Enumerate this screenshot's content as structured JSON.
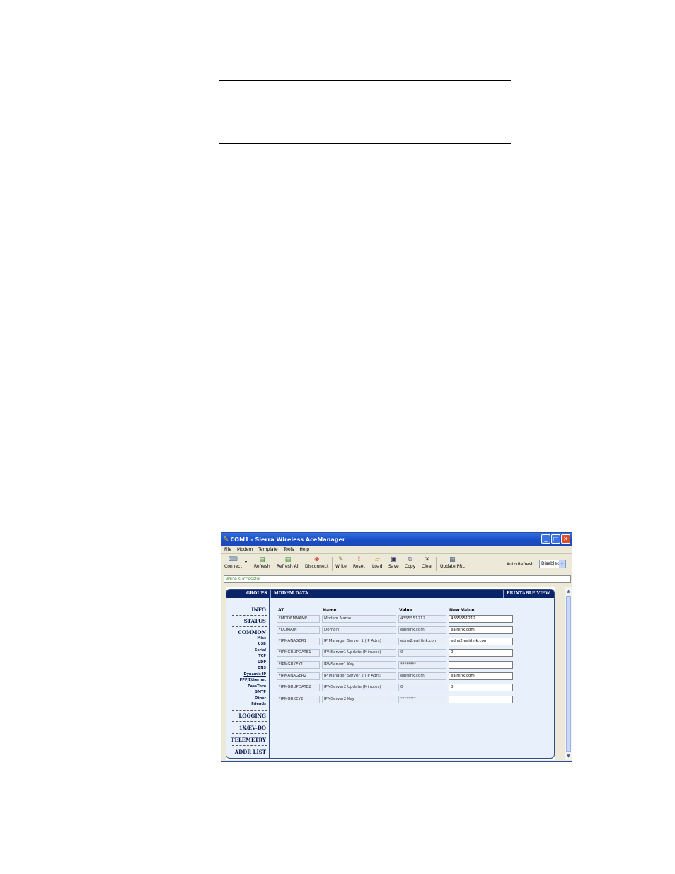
{
  "window": {
    "title": "COM1 - Sierra Wireless AceManager",
    "menu": [
      "File",
      "Modem",
      "Template",
      "Tools",
      "Help"
    ],
    "toolbar": {
      "connect": "Connect",
      "refresh": "Refresh",
      "refresh_all": "Refresh All",
      "disconnect": "Disconnect",
      "write": "Write",
      "reset": "Reset",
      "load": "Load",
      "save": "Save",
      "copy": "Copy",
      "clear": "Clear",
      "update_prl": "Update PRL",
      "auto_refresh_label": "Auto Refresh",
      "auto_refresh_value": "Disabled"
    },
    "status_message": "Write successful",
    "headers": {
      "groups": "GROUPS",
      "modem_data": "MODEM DATA",
      "printable_view": "PRINTABLE VIEW"
    },
    "groups": {
      "info": "INFO",
      "status": "STATUS",
      "common": "COMMON",
      "common_items": [
        "Misc",
        "USB",
        "Serial",
        "TCP",
        "UDP",
        "DNS",
        "Dynamic IP",
        "PPP/Ethernet",
        "PassThru",
        "SMTP",
        "Other",
        "Friends"
      ],
      "logging": "LOGGING",
      "evdo": "1X/EV-DO",
      "telemetry": "TELEMETRY",
      "addr_list": "ADDR LIST"
    },
    "table": {
      "columns": [
        "AT",
        "Name",
        "Value",
        "New Value"
      ],
      "rows": [
        {
          "at": "*MODEMNAME",
          "name": "Modem Name",
          "value": "4355551212",
          "new_value": "4355551212"
        },
        {
          "at": "*DOMAIN",
          "name": "Domain",
          "value": "eairlink.com",
          "new_value": "eairlink.com"
        },
        {
          "at": "*IPMANAGER1",
          "name": "IP Manager Server 1 (IP Adrs)",
          "value": "edns2.eairlink.com",
          "new_value": "edns2.eairlink.com"
        },
        {
          "at": "*IPMGRUPDATE1",
          "name": "IPMServer1 Update (Minutes)",
          "value": "0",
          "new_value": "0"
        },
        {
          "at": "*IPMGRKEY1",
          "name": "IPMServer1 Key",
          "value": "********",
          "new_value": ""
        },
        {
          "at": "*IPMANAGER2",
          "name": "IP Manager Server 2 (IP Adrs)",
          "value": "eairlink.com",
          "new_value": "eairlink.com"
        },
        {
          "at": "*IPMGRUPDATE2",
          "name": "IPMServer2 Update (Minutes)",
          "value": "0",
          "new_value": "0"
        },
        {
          "at": "*IPMGRKEY2",
          "name": "IPMServer2 Key",
          "value": "********",
          "new_value": ""
        }
      ]
    }
  }
}
